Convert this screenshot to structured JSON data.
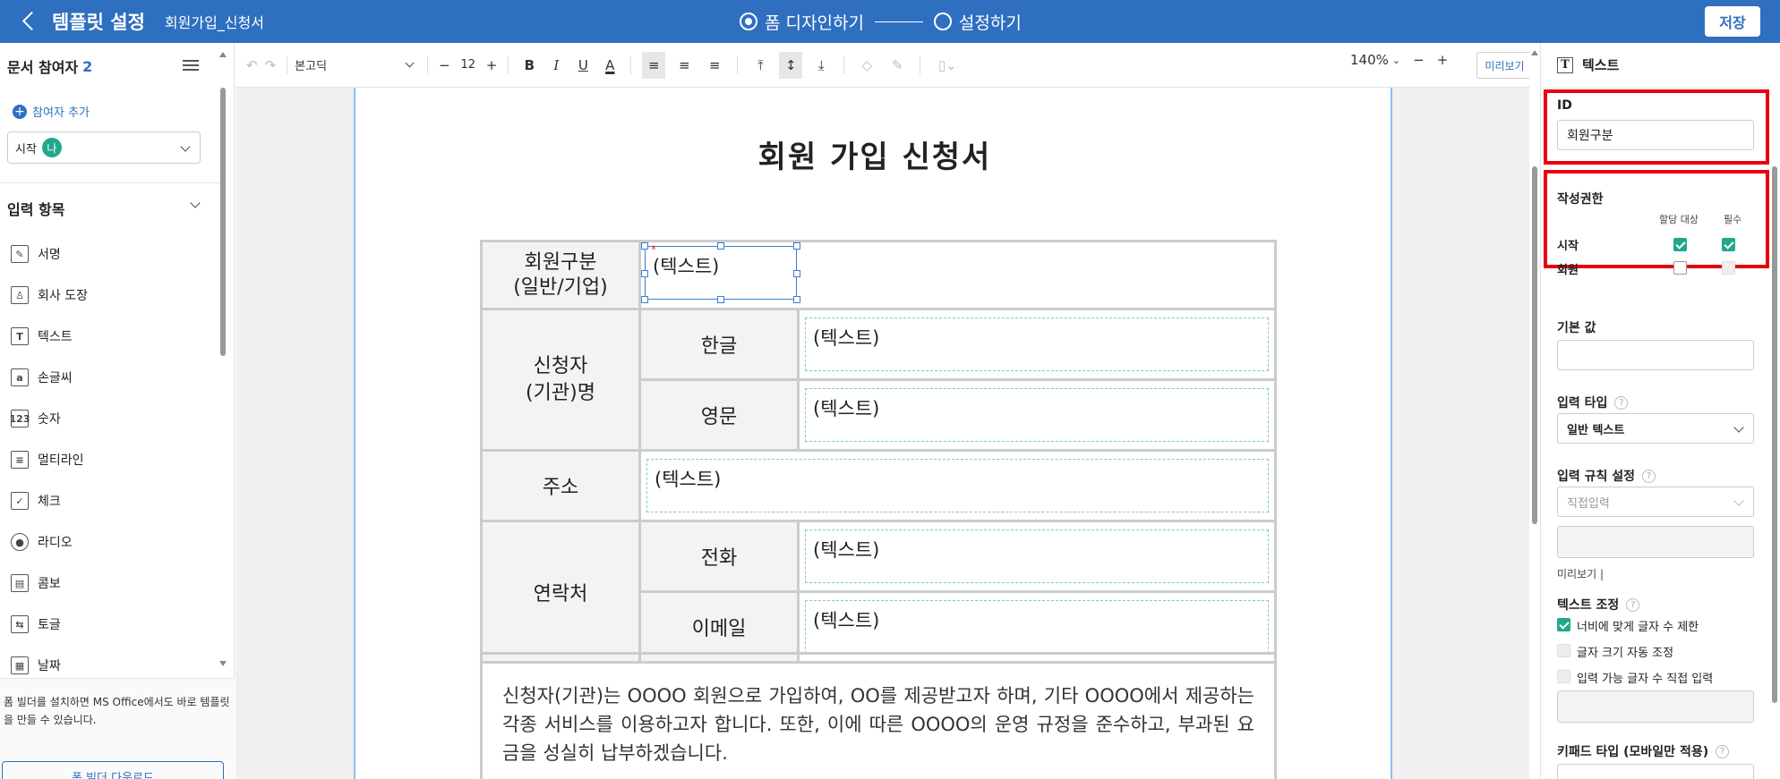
{
  "header": {
    "title": "템플릿 설정",
    "doc_name": "회원가입_신청서",
    "mode_design": "폼 디자인하기",
    "mode_settings": "설정하기",
    "save": "저장"
  },
  "left": {
    "participants_label": "문서 참여자",
    "participants_count": "2",
    "add_participant": "참여자 추가",
    "participant_select": "시작",
    "participant_badge": "나",
    "input_items_label": "입력 항목",
    "items": [
      {
        "label": "서명",
        "icon": "signature-icon",
        "glyph": "✎"
      },
      {
        "label": "회사 도장",
        "icon": "stamp-icon",
        "glyph": "♙"
      },
      {
        "label": "텍스트",
        "icon": "text-icon",
        "glyph": "T"
      },
      {
        "label": "손글씨",
        "icon": "handwriting-icon",
        "glyph": "a"
      },
      {
        "label": "숫자",
        "icon": "number-icon",
        "glyph": "123"
      },
      {
        "label": "멀티라인",
        "icon": "multiline-icon",
        "glyph": "≡"
      },
      {
        "label": "체크",
        "icon": "check-icon",
        "glyph": "✓"
      },
      {
        "label": "라디오",
        "icon": "radio-icon",
        "glyph": "●"
      },
      {
        "label": "콤보",
        "icon": "combo-icon",
        "glyph": "▤"
      },
      {
        "label": "토글",
        "icon": "toggle-icon",
        "glyph": "⇆"
      },
      {
        "label": "날짜",
        "icon": "calendar-icon",
        "glyph": "▦"
      }
    ],
    "footer_msg": "폼 빌더를 설치하면 MS Office에서도 바로 템플릿을 만들 수 있습니다.",
    "download": "폼 빌더 다운로드"
  },
  "toolbar": {
    "font": "본고딕",
    "size": "12",
    "zoom": "140%",
    "preview": "미리보기"
  },
  "doc": {
    "title": "회원 가입 신청서",
    "placeholder": "(텍스트)",
    "row_member_type": "회원구분\n(일반/기업)",
    "row_applicant": "신청자\n(기관)명",
    "row_korean": "한글",
    "row_english": "영문",
    "row_address": "주소",
    "row_contact": "연락처",
    "row_phone": "전화",
    "row_email": "이메일",
    "paragraph": "신청자(기관)는 OOOO 회원으로 가입하여, OO를 제공받고자 하며, 기타 OOOO에서 제공하는 각종 서비스를 이용하고자 합니다. 또한, 이에 따른 OOOO의 운영 규정을 준수하고, 부과된 요금을 성실히 납부하겠습니다."
  },
  "right": {
    "panel_title": "텍스트",
    "id_label": "ID",
    "id_value": "회원구분",
    "perm_label": "작성권한",
    "col_assign": "할당 대상",
    "col_required": "필수",
    "perm_row1": "시작",
    "perm_row2": "회원",
    "default_label": "기본 값",
    "input_type_label": "입력 타입",
    "input_type_value": "일반 텍스트",
    "rule_label": "입력 규칙 설정",
    "rule_value": "직접입력",
    "preview_label": "미리보기 |",
    "adjust_label": "텍스트 조정",
    "opt1": "너비에 맞게 글자 수 제한",
    "opt2": "글자 크기 자동 조정",
    "opt3": "입력 가능 글자 수 직접 입력",
    "keypad_label": "키패드 타입 (모바일만 적용)"
  },
  "colors": {
    "accent": "#2f6fc0",
    "teal": "#1fa88d",
    "highlight": "#e8000a"
  }
}
